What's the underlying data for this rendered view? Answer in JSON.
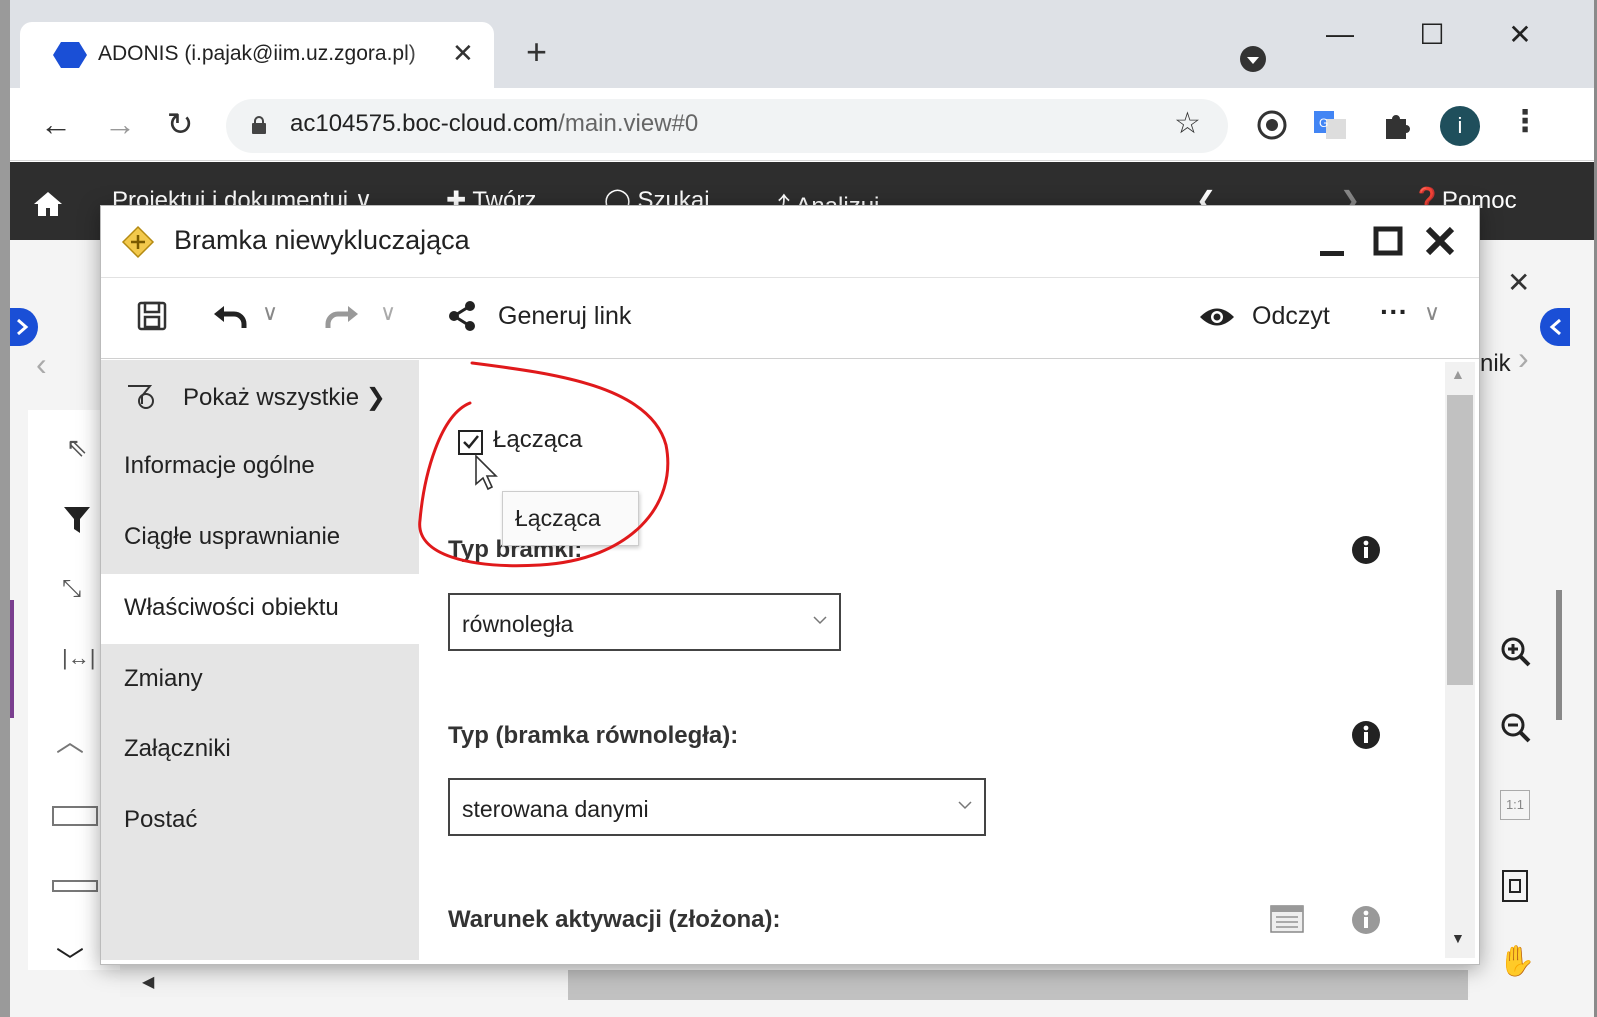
{
  "browser": {
    "tab_title": "ADONIS (i.pajak@iim.uz.zgora.pl)",
    "tab_close": "✕",
    "new_tab": "+",
    "window_min": "—",
    "window_max": "☐",
    "window_close": "✕",
    "url_host": "ac104575.boc-cloud.com",
    "url_path": "/main.view#0",
    "avatar_letter": "i",
    "accent": "#1a4fd6"
  },
  "app": {
    "nav": {
      "home_icon": "home-icon",
      "projects": "Projektuj i dokumentuj ∨",
      "create": "Twórz",
      "search": "Szukaj",
      "analyze": "Analizuj",
      "help": "Pomoc"
    },
    "behind_right_label": "nik",
    "behind_close": "✕"
  },
  "modal": {
    "title": "Bramka niewykluczająca",
    "toolbar": {
      "generate_link": "Generuj link",
      "read_mode": "Odczyt"
    },
    "sidebar": {
      "show_all": "Pokaż wszystkie",
      "items": [
        {
          "label": "Informacje ogólne"
        },
        {
          "label": "Ciągłe usprawnianie"
        },
        {
          "label": "Właściwości obiektu",
          "active": true
        },
        {
          "label": "Zmiany"
        },
        {
          "label": "Załączniki"
        },
        {
          "label": "Postać"
        }
      ]
    },
    "content": {
      "checkbox_label": "Łącząca",
      "checkbox_checked": true,
      "tooltip": "Łącząca",
      "gate_type_label": "Typ bramki:",
      "gate_type_value": "równoległa",
      "parallel_type_label": "Typ (bramka równoległa):",
      "parallel_type_value": "sterowana danymi",
      "activation_label": "Warunek aktywacji (złożona):"
    },
    "annotation_color": "#e0191b"
  }
}
